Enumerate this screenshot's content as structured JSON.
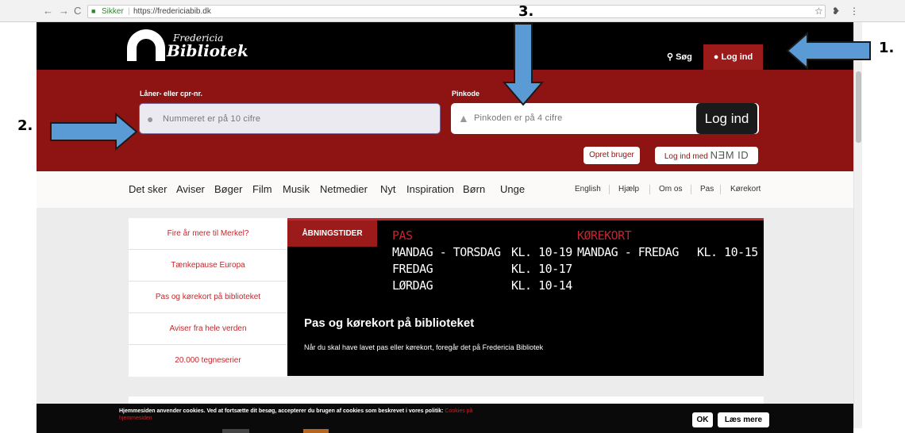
{
  "browser": {
    "back": "←",
    "forward": "→",
    "reload": "C",
    "secure_label": "Sikker",
    "url": "https://fredericiabib.dk",
    "star_icon": "☆",
    "menu_icon": "⋮"
  },
  "header": {
    "logo_small": "Fredericia",
    "logo_big": "Bibliotek",
    "search_label": "Søg",
    "login_label": "Log ind"
  },
  "login": {
    "user_label": "Låner- eller cpr-nr.",
    "user_placeholder": "Nummeret er på 10 cifre",
    "pin_label": "Pinkode",
    "pin_placeholder": "Pinkoden er på 4 cifre",
    "submit_label": "Log ind",
    "create_user_label": "Opret bruger",
    "nemid_prefix": "Log ind med",
    "nemid_logo": "NƎM ID"
  },
  "nav": {
    "items": [
      "Det sker",
      "Aviser",
      "Bøger",
      "Film",
      "Musik",
      "Netmedier",
      "Nyt",
      "Inspiration",
      "Børn",
      "Unge"
    ],
    "sub_items": [
      "English",
      "Hjælp",
      "Om os",
      "Pas",
      "Kørekort"
    ]
  },
  "sidebar": {
    "items": [
      "Fire år mere til Merkel?",
      "Tænkepause Europa",
      "Pas og kørekort på biblioteket",
      "Aviser fra hele verden",
      "20.000 tegneserier"
    ]
  },
  "hero": {
    "tab_label": "ÅBNINGSTIDER",
    "pas_heading": "PAS",
    "pas_lines": [
      "MANDAG - TORSDAG",
      "FREDAG",
      "LØRDAG"
    ],
    "pas_times": [
      "KL. 10-19",
      "KL. 10-17",
      "KL. 10-14"
    ],
    "korekort_heading": "KØREKORT",
    "korekort_day": "MANDAG - FREDAG",
    "korekort_time": "KL. 10-15",
    "title": "Pas og kørekort på biblioteket",
    "text": "Når du skal have lavet pas eller kørekort, foregår det på Fredericia Bibliotek"
  },
  "cookie": {
    "text": "Hjemmesiden anvender cookies. Ved at fortsætte dit besøg, accepterer du brugen af cookies som beskrevet i vores politik:",
    "link": "Cookies på hjemmesiden",
    "ok_label": "OK",
    "more_label": "Læs mere"
  },
  "annotations": {
    "a1": "1.",
    "a2": "2.",
    "a3": "3."
  },
  "colors": {
    "brand_red": "#8e1313",
    "accent_red": "#c0272d",
    "arrow_blue": "#5b9bd5"
  }
}
